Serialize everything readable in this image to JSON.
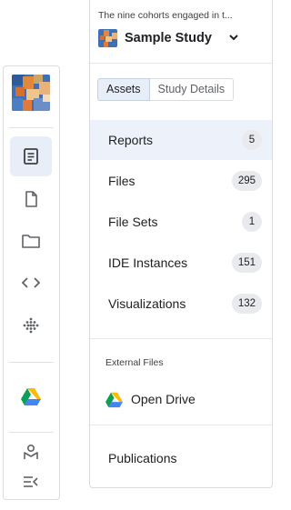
{
  "study": {
    "description": "The nine cohorts engaged in t...",
    "title": "Sample Study"
  },
  "tabs": [
    {
      "label": "Assets"
    },
    {
      "label": "Study Details"
    }
  ],
  "nav": [
    {
      "label": "Reports",
      "count": "5"
    },
    {
      "label": "Files",
      "count": "295"
    },
    {
      "label": "File Sets",
      "count": "1"
    },
    {
      "label": "IDE Instances",
      "count": "151"
    },
    {
      "label": "Visualizations",
      "count": "132"
    }
  ],
  "external": {
    "section_label": "External Files",
    "drive_label": "Open Drive"
  },
  "publications_label": "Publications",
  "rail_icons": [
    "study-thumbnail",
    "reports-icon",
    "file-icon",
    "folder-icon",
    "code-icon",
    "dots-grid-icon",
    "google-drive-icon",
    "user-badge-icon",
    "collapse-menu-icon"
  ],
  "colors": {
    "active_bg": "#edf2fa",
    "badge_bg": "#e8eaed",
    "icon_gray": "#5f6368"
  }
}
